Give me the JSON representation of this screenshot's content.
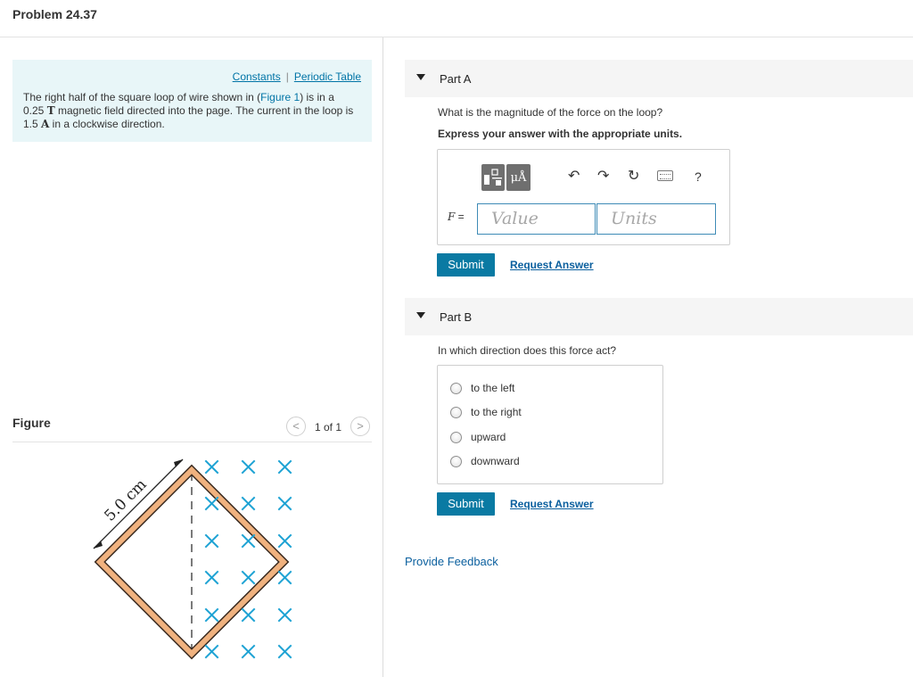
{
  "page": {
    "title": "Problem 24.37"
  },
  "intro": {
    "constants_link": "Constants",
    "separator": "|",
    "periodic_table_link": "Periodic Table",
    "text_1": "The right half of the square loop of wire shown in (",
    "figure_link": "Figure 1",
    "text_2": ") is in a",
    "field_value": "0.25",
    "field_unit": "T",
    "text_3": " magnetic field directed into the page. The current in the loop is",
    "current_value": "1.5",
    "current_unit": "A",
    "text_4": " in a clockwise direction."
  },
  "figure": {
    "label": "Figure",
    "pager": {
      "prev": "<",
      "count": "1 of 1",
      "next": ">"
    },
    "dimension_label": "5.0 cm",
    "colors": {
      "field_x": "#1fa3d4",
      "wire_fill": "#f0b27f",
      "wire_edge": "#3a2a1f"
    }
  },
  "partA": {
    "title": "Part A",
    "question": "What is the magnitude of the force on the loop?",
    "instruction": "Express your answer with the appropriate units.",
    "toolbar": {
      "templates_icon": "templates-icon",
      "units_symbol": "μÅ",
      "undo_icon": "↶",
      "redo_icon": "↷",
      "reset_icon": "↻",
      "keyboard_icon": "keyboard-icon",
      "help_icon": "?"
    },
    "variable": "F",
    "equals": " =",
    "value_placeholder": "Value",
    "units_placeholder": "Units",
    "submit": "Submit",
    "request": "Request Answer"
  },
  "partB": {
    "title": "Part B",
    "question": "In which direction does this force act?",
    "options": [
      "to the left",
      "to the right",
      "upward",
      "downward"
    ],
    "submit": "Submit",
    "request": "Request Answer"
  },
  "footer": {
    "feedback": "Provide Feedback"
  }
}
